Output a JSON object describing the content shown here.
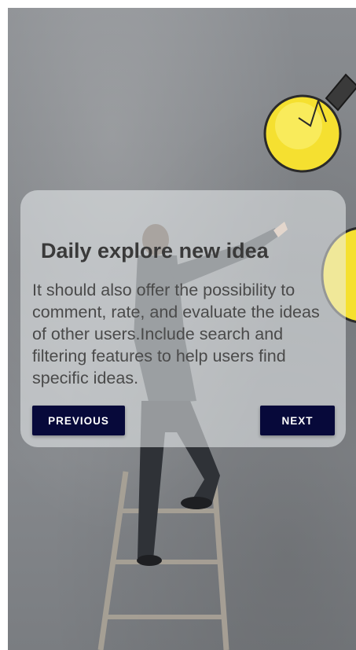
{
  "onboarding": {
    "title": "Daily explore new idea",
    "description": "It should also offer the possibility to comment, rate, and evaluate the ideas of other users.Include search and filtering features to help users find specific ideas.",
    "previous_label": "PREVIOUS",
    "next_label": "NEXT"
  },
  "colors": {
    "button_background": "#07093a",
    "button_text": "#ffffff",
    "wall_background": "#808387",
    "bulb_yellow": "#f5e030"
  },
  "background_image": {
    "icons": [
      "man-climbing-ladder-illustration",
      "light-bulb-icon"
    ]
  }
}
